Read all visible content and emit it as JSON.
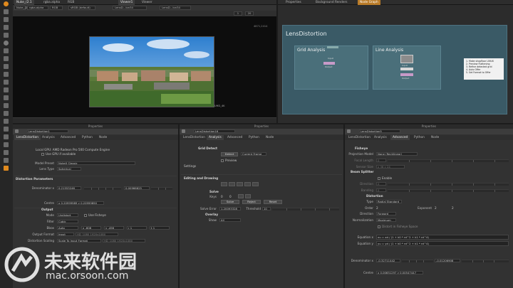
{
  "viewer_tabs": [
    "Nuke_(2.1",
    "rgba.alpha",
    "RGB",
    "sRGB (default)",
    "Viewer1",
    "Viewer",
    "LensD...ion34",
    "LensD...ion34",
    "Properties",
    "Background Renders",
    "Node Graph"
  ],
  "viewer": {
    "resolution": "4871,2414",
    "format": "UHD_4K",
    "zoom": "20",
    "frame_field": "1"
  },
  "node_graph": {
    "title": "LensDistortion",
    "backdrops": [
      {
        "label": "Grid Analysis"
      },
      {
        "label": "Line Analysis"
      }
    ],
    "sticky_note": [
      "1. Make shopfloor LINUX",
      "2. Preview Flattening",
      "3. Refine detected grid",
      "4. Auto Offer",
      "5. Set Format to Offer"
    ],
    "node_labels": [
      "Input",
      "Output",
      "Input",
      "Output"
    ]
  },
  "props_header": "Properties",
  "panels": [
    {
      "node_name": "LensDistortion1",
      "tabs": [
        "LensDistortion",
        "Analysis",
        "Advanced",
        "Python",
        "Node"
      ],
      "gpu_line": "Local GPU: AMD Radeon Pro 500 Compute Engine",
      "use_gpu": "Use GPU if available",
      "model_preset_label": "Model Preset",
      "model_preset": "NukeX Classic",
      "lens_type_label": "Lens Type",
      "lens_type": "Spherical",
      "section_distortion": "Distortion Parameters",
      "denominator_label": "Denominator x",
      "denominator_x": "0.21553246",
      "denominator_y": "0.00966625",
      "centre_label": "Centre",
      "centre": "x 0.20999989  y 0.20999890",
      "section_output": "Output",
      "mode_label": "Mode",
      "mode": "Undistort",
      "use_fisheye": "Use Fisheye",
      "filter_label": "Filter",
      "filter": "Cubic",
      "bbox_label": "Bbox",
      "bbox": "Auto",
      "bbox_vals": [
        "x -608",
        "y -456",
        "r 1",
        "t 1"
      ],
      "output_format_label": "Output Format",
      "output_format": "Input",
      "output_format_desc": "HD_1080 1920x1080",
      "distortion_scaling_label": "Distortion Scaling",
      "distortion_scaling": "Scale To Input Format",
      "distortion_scaling_desc": "HD_1080 1920x1080"
    },
    {
      "node_name": "LensDistortion16",
      "tabs": [
        "LensDistortion",
        "Analysis",
        "Advanced",
        "Python",
        "Node"
      ],
      "section_grid": "Grid Detect",
      "detect_btn": "Detect",
      "current_frame": "Current Frame",
      "preview": "Preview",
      "settings": "Settings",
      "section_editing": "Editing and Drawing",
      "solve_header": "Solve",
      "keys_label": "Keys",
      "keys_value": "0",
      "keys_value2": "0",
      "solve_btn": "Solve",
      "reject_btn": "Reject",
      "reset_btn": "Reset",
      "solve_error_label": "Solve Error",
      "solve_error": "1.20093328",
      "threshold_label": "Threshold",
      "threshold": "10",
      "overlay_header": "Overlay",
      "show_label": "Show",
      "show_value": "All"
    },
    {
      "node_name": "LensDistortion5",
      "tabs": [
        "LensDistortion",
        "Analysis",
        "Advanced",
        "Python",
        "Node"
      ],
      "section_fisheye": "Fisheye",
      "projection_label": "Projection Model",
      "projection": "None (Rectilinear)",
      "focal_label": "Focal Length",
      "focal_value": "0",
      "sensor_label": "Sensor Size",
      "sensor_value": "x 36    y 24",
      "section_beam": "Beam Splitter",
      "enable": "Enable",
      "direction_label": "Direction",
      "direction_value": "0",
      "banding_label": "Banding",
      "banding_value": "0",
      "section_distortion": "Distortion",
      "type_label": "Type",
      "type_value": "Radial Standard",
      "order_label": "Order",
      "order_value": "2",
      "exponent_label": "Exponent",
      "exponent_value": "2",
      "exponent_value2": "2",
      "direction2_label": "Direction",
      "direction2_value": "Forward",
      "normalization_label": "Normalization",
      "normalization_value": "Maximum",
      "distort_fisheye": "Distort in Fisheye Space",
      "eq_x_label": "Equation x",
      "eq_x": "xu = xd / (1 + k0 * rd^2 + k1 * rd^4)",
      "eq_y_label": "Equation y",
      "eq_y": "yu = yd / (1 + k0 * rd^2 + k1 * rd^4)",
      "denominator_label": "Denominator x",
      "denominator_x": "-0.32711442",
      "denominator_y": "-0.01206908",
      "centre_label": "Centre",
      "centre": "x 0.00651297  y 0.00547447"
    }
  ],
  "watermark": {
    "brand": "未来软件园",
    "url": "mac.orsoon.com"
  },
  "colors": {
    "accent": "#b97b28",
    "node_graph_bg": "#3a5a66",
    "backdrop": "#4a6f7a",
    "node_pink": "#c89ac8"
  }
}
